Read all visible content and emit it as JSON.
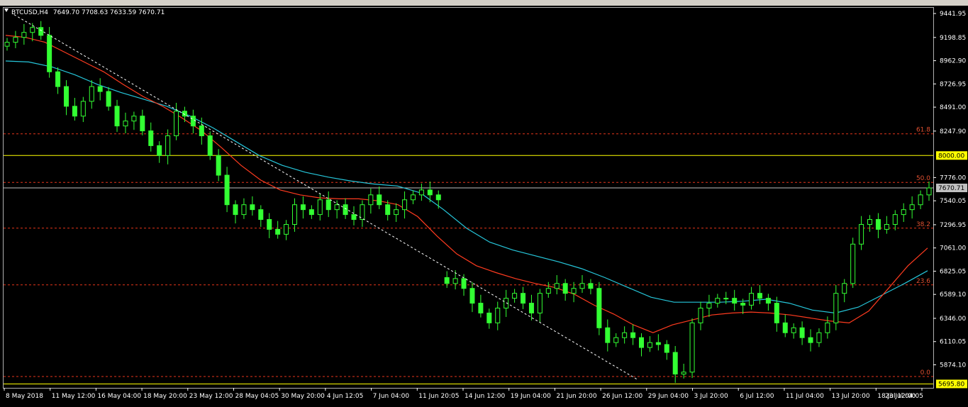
{
  "chart_data": {
    "type": "candlestick",
    "title": "BTCUSD,H4",
    "ohlc_last": "7649.70 7708.63 7633.59 7670.71",
    "symbol_colors": {
      "bull": "#33ff33",
      "bear": "#33ff33",
      "ma_fast": "#ff3b1f",
      "ma_slow": "#26c6da",
      "trend": "#ffffff",
      "grid_fibo": "#ff3b1f",
      "level": "#ffff00",
      "price_line": "#c0c0c0",
      "background": "#000000"
    },
    "ylim": [
      5640,
      9500
    ],
    "price_ticks": [
      "9441.95",
      "9198.85",
      "8962.90",
      "8726.95",
      "8491.00",
      "8247.90",
      "7776.00",
      "7540.05",
      "7296.95",
      "7061.00",
      "6825.05",
      "6589.10",
      "6346.00",
      "6110.05",
      "5874.10"
    ],
    "time_ticks": [
      "8 May 2018",
      "11 May 12:00",
      "16 May 04:00",
      "18 May 20:00",
      "23 May 12:00",
      "28 May 04:05",
      "30 May 20:00",
      "4 Jun 12:05",
      "7 Jun 04:00",
      "11 Jun 20:05",
      "14 Jun 12:00",
      "19 Jun 04:00",
      "21 Jun 20:00",
      "26 Jun 12:00",
      "29 Jun 04:00",
      "3 Jul 20:00",
      "6 Jul 12:00",
      "11 Jul 04:00",
      "13 Jul 20:00",
      "18 Jul 12:00",
      "23 Jul 04:05"
    ],
    "fibonacci": [
      {
        "label": "61.8",
        "price": 8220
      },
      {
        "label": "50.0",
        "price": 7727
      },
      {
        "label": "38.2",
        "price": 7262
      },
      {
        "label": "23.6",
        "price": 6686
      },
      {
        "label": "0.0",
        "price": 5755
      }
    ],
    "levels": [
      {
        "label": "8000.00",
        "price": 8000,
        "boxed": true,
        "color": "#ffff00"
      },
      {
        "label": "7670.71",
        "price": 7670.71,
        "boxed": true,
        "color": "#c0c0c0"
      },
      {
        "label": "5695.80",
        "price": 5680,
        "boxed": true,
        "color": "#ffff00"
      }
    ],
    "trendline": {
      "from_price": 9430,
      "to_price": 5720
    },
    "closes": [
      9150,
      9200,
      9250,
      9300,
      9220,
      8850,
      8700,
      8500,
      8400,
      8550,
      8700,
      8650,
      8500,
      8300,
      8350,
      8400,
      8250,
      8100,
      8000,
      8200,
      8450,
      8400,
      8300,
      8200,
      8000,
      7800,
      7500,
      7400,
      7500,
      7450,
      7350,
      7250,
      7200,
      7300,
      7500,
      7450,
      7400,
      7550,
      7450,
      7500,
      7400,
      7350,
      7500,
      7600,
      7500,
      7400,
      7450,
      7550,
      7600,
      7650,
      7600,
      7550,
      6700,
      6750,
      6650,
      6500,
      6400,
      6300,
      6450,
      6550,
      6600,
      6500,
      6400,
      6600,
      6650,
      6700,
      6600,
      6650,
      6700,
      6650,
      6250,
      6100,
      6150,
      6200,
      6150,
      6050,
      6100,
      6080,
      6000,
      5780,
      5800,
      6300,
      6450,
      6500,
      6550,
      6550,
      6500,
      6480,
      6600,
      6550,
      6500,
      6300,
      6200,
      6250,
      6150,
      6100,
      6200,
      6300,
      6600,
      6700,
      7100,
      7300,
      7350,
      7250,
      7300,
      7400,
      7450,
      7500,
      7600,
      7670.71
    ],
    "ma_fast": [
      9220,
      9200,
      9150,
      9050,
      8950,
      8850,
      8720,
      8600,
      8500,
      8380,
      8250,
      8080,
      7900,
      7750,
      7650,
      7600,
      7570,
      7560,
      7560,
      7540,
      7500,
      7380,
      7180,
      7000,
      6880,
      6810,
      6750,
      6700,
      6660,
      6590,
      6480,
      6390,
      6280,
      6200,
      6280,
      6330,
      6380,
      6400,
      6410,
      6400,
      6380,
      6350,
      6320,
      6300,
      6420,
      6650,
      6880,
      7060
    ],
    "ma_slow": [
      8960,
      8950,
      8900,
      8820,
      8720,
      8640,
      8570,
      8500,
      8400,
      8280,
      8140,
      8000,
      7900,
      7830,
      7780,
      7740,
      7710,
      7690,
      7620,
      7450,
      7260,
      7120,
      7040,
      6980,
      6920,
      6850,
      6760,
      6660,
      6560,
      6510,
      6510,
      6510,
      6520,
      6540,
      6500,
      6430,
      6400,
      6460,
      6580,
      6700,
      6830
    ]
  }
}
